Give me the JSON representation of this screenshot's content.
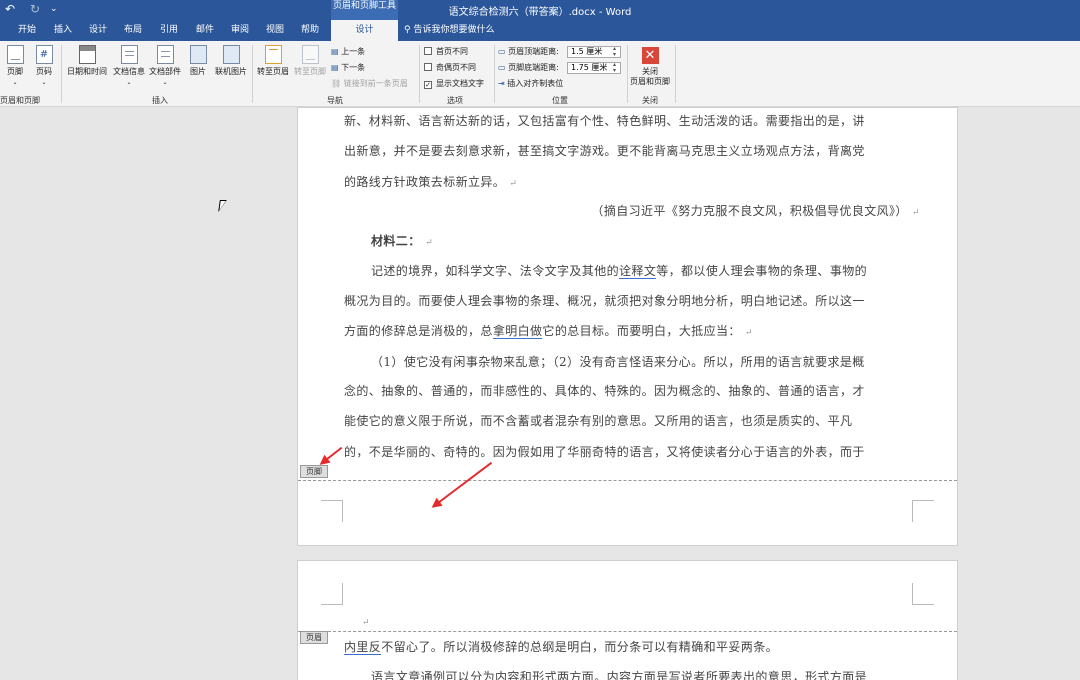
{
  "window": {
    "title": "语文综合检测六（带答案）.docx  -  Word",
    "context_tool": "页眉和页脚工具"
  },
  "qat": {
    "undo": "↶",
    "redo": "↻",
    "more": "⌄"
  },
  "tabs": [
    "开始",
    "插入",
    "设计",
    "布局",
    "引用",
    "邮件",
    "审阅",
    "视图",
    "帮助",
    "设计"
  ],
  "tell_me": "告诉我你想要做什么",
  "ribbon": {
    "footer": "页脚",
    "page_number": "页码",
    "group_hf": "页眉和页脚",
    "date_time": "日期和时间",
    "doc_info": "文档信息",
    "doc_parts": "文档部件",
    "picture": "图片",
    "online_picture": "联机图片",
    "group_insert": "插入",
    "goto_header": "转至页眉",
    "goto_footer": "转至页脚",
    "prev": "上一条",
    "next": "下一条",
    "link_prev": "链接到前一条页眉",
    "group_nav": "导航",
    "diff_first": "首页不同",
    "diff_odd_even": "奇偶页不同",
    "show_text": "显示文档文字",
    "group_options": "选项",
    "header_dist_label": "页眉顶端距离:",
    "header_dist_value": "1.5 厘米",
    "footer_dist_label": "页脚底端距离:",
    "footer_dist_value": "1.75 厘米",
    "insert_align_tab": "插入对齐制表位",
    "group_position": "位置",
    "close_line1": "关闭",
    "close_line2": "页眉和页脚",
    "group_close": "关闭"
  },
  "doc": {
    "l1": "新、材料新、语言新达新的话，又包括富有个性、特色鲜明、生动活泼的话。需要指出的是，讲",
    "l2": "出新意，并不是要去刻意求新，甚至搞文字游戏。更不能背离马克思主义立场观点方法，背离党",
    "l3": "的路线方针政策去标新立异。",
    "l4": "（摘自习近平《努力克服不良文风，积极倡导优良文风》）",
    "l5": "材料二：",
    "l6a": "记述的境界，如科学文字、法令文字及其他的",
    "l6u": "诠释文",
    "l6b": "等，都以使人理会事物的条理、事物的",
    "l7": "概况为目的。而要使人理会事物的条理、概况，就须把对象分明地分析，明白地记述。所以这一",
    "l8a": "方面的修辞总是消极的，总",
    "l8u": "拿明白做",
    "l8b": "它的总目标。而要明白，大抵应当：",
    "l9": "（1）使它没有闲事杂物来乱意；（2）没有奇言怪语来分心。所以，所用的语言就要求是概",
    "l10": "念的、抽象的、普通的，而非感性的、具体的、特殊的。因为概念的、抽象的、普通的语言，才",
    "l11": "能使它的意义限于所说，而不含蓄或者混杂有别的意思。又所用的语言，也须是质实的、平凡",
    "l12": "的，不是华丽的、奇特的。因为假如用了华丽奇特的语言，又将使读者分心于语言的外表，而于",
    "footer_tag": "页脚",
    "header_tag": "页眉",
    "p2u": "内里反",
    "p2l1": "不留心了。所以消极修辞的总纲是明白，而分条可以有精确和平妥两条。",
    "p2l2": "语言文章通例可以分为内容和形式两方面。内容方面是写说者所要表出的意思，形式方面是"
  },
  "marks": {
    "para": "↵"
  },
  "colors": {
    "accent": "#2b579a",
    "arrow": "#e32b2b",
    "close": "#d9473b"
  }
}
